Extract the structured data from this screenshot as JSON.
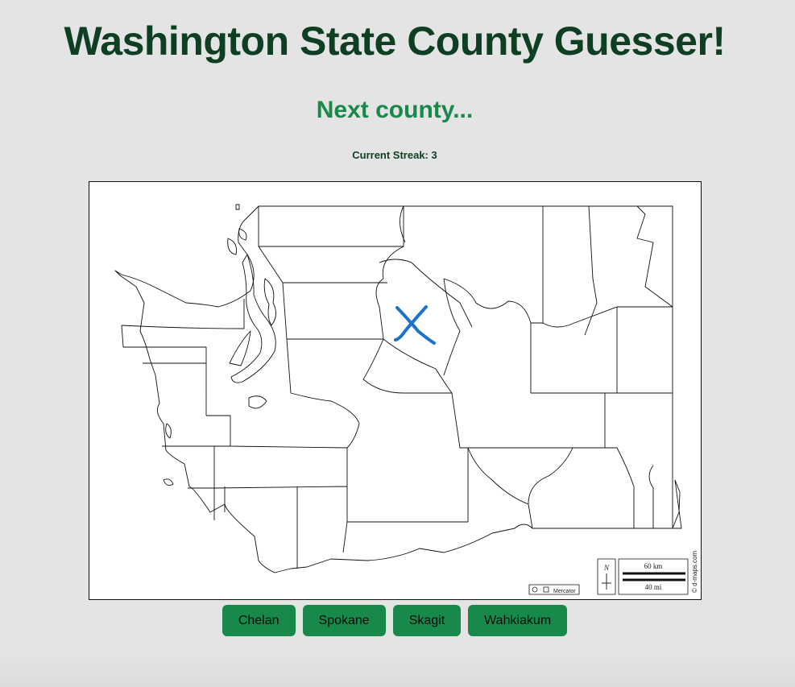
{
  "page": {
    "title": "Washington State County Guesser!",
    "prompt": "Next county...",
    "streak_text": "Current Streak: 3"
  },
  "map": {
    "credit": "© d-maps.com",
    "projection_label": "Mercator",
    "scale_km": "60 km",
    "scale_mi": "40 mi",
    "north_label": "N",
    "marker_color": "#1a73c8"
  },
  "answers": [
    {
      "label": "Chelan"
    },
    {
      "label": "Spokane"
    },
    {
      "label": "Skagit"
    },
    {
      "label": "Wahkiakum"
    }
  ],
  "colors": {
    "title": "#0e3f22",
    "prompt": "#17894a",
    "button": "#17894a",
    "background": "#e4e4e4"
  }
}
